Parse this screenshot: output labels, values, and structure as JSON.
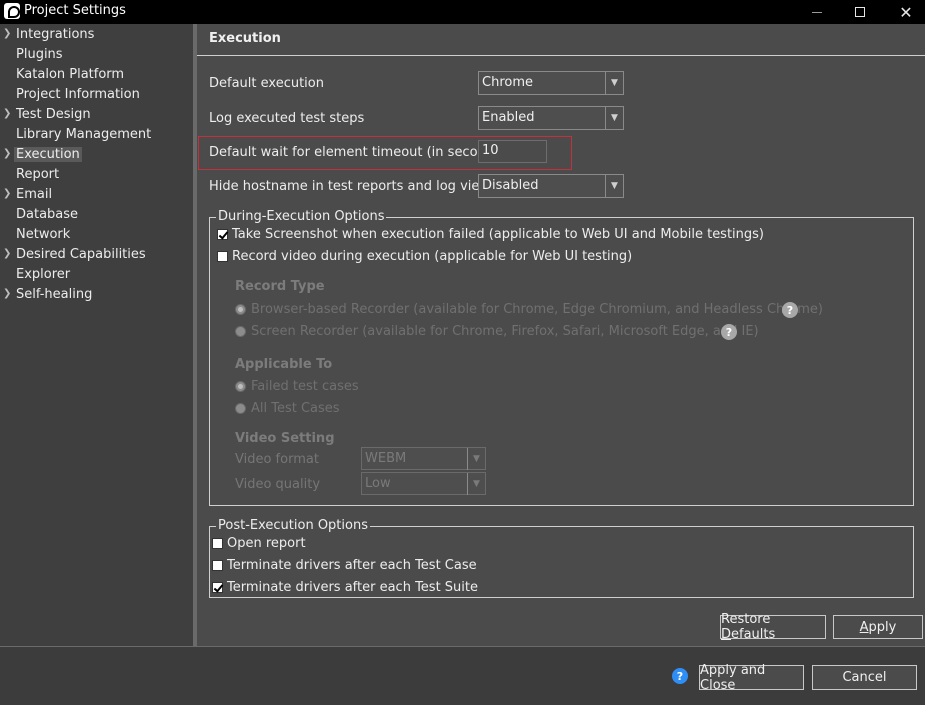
{
  "window": {
    "title": "Project Settings"
  },
  "sidebar": {
    "items": [
      {
        "label": "Integrations",
        "expandable": true
      },
      {
        "label": "Plugins",
        "expandable": false
      },
      {
        "label": "Katalon Platform",
        "expandable": false
      },
      {
        "label": "Project Information",
        "expandable": false
      },
      {
        "label": "Test Design",
        "expandable": true
      },
      {
        "label": "Library Management",
        "expandable": false
      },
      {
        "label": "Execution",
        "expandable": true,
        "selected": true
      },
      {
        "label": "Report",
        "expandable": false
      },
      {
        "label": "Email",
        "expandable": true
      },
      {
        "label": "Database",
        "expandable": false
      },
      {
        "label": "Network",
        "expandable": false
      },
      {
        "label": "Desired Capabilities",
        "expandable": true
      },
      {
        "label": "Explorer",
        "expandable": false
      },
      {
        "label": "Self-healing",
        "expandable": true
      }
    ]
  },
  "main": {
    "title": "Execution",
    "default_execution": {
      "label": "Default execution",
      "value": "Chrome"
    },
    "log_steps": {
      "label": "Log executed test steps",
      "value": "Enabled"
    },
    "wait_timeout": {
      "label": "Default wait for element timeout (in seconds)",
      "value": "10"
    },
    "hide_hostname": {
      "label": "Hide hostname in test reports and log viewer",
      "value": "Disabled"
    },
    "during": {
      "legend": "During-Execution Options",
      "take_screenshot": {
        "label": "Take Screenshot when execution failed (applicable to Web UI and Mobile testings)",
        "checked": true
      },
      "record_video": {
        "label": "Record video during execution (applicable for Web UI testing)",
        "checked": false
      },
      "record_type": {
        "heading": "Record Type",
        "browser": "Browser-based Recorder (available for Chrome, Edge Chromium, and Headless Chrome)",
        "screen": "Screen Recorder (available for Chrome, Firefox, Safari, Microsoft Edge, and IE)"
      },
      "applicable_to": {
        "heading": "Applicable To",
        "failed": "Failed test cases",
        "all": "All Test Cases"
      },
      "video_setting": {
        "heading": "Video Setting",
        "format_label": "Video format",
        "format_value": "WEBM",
        "quality_label": "Video quality",
        "quality_value": "Low"
      }
    },
    "post": {
      "legend": "Post-Execution Options",
      "open_report": {
        "label": "Open report",
        "checked": false
      },
      "terminate_case": {
        "label": "Terminate drivers after each Test Case",
        "checked": false
      },
      "terminate_suite": {
        "label": "Terminate drivers after each Test Suite",
        "checked": true
      }
    },
    "buttons": {
      "restore_prefix": "Restore ",
      "restore_u": "D",
      "restore_suffix": "efaults",
      "apply_u": "A",
      "apply_suffix": "pply"
    }
  },
  "footer": {
    "help": "?",
    "apply_close": "Apply and Close",
    "cancel": "Cancel"
  },
  "colors": {
    "highlight": "#c0323c",
    "help_blue": "#2f8ef5"
  }
}
